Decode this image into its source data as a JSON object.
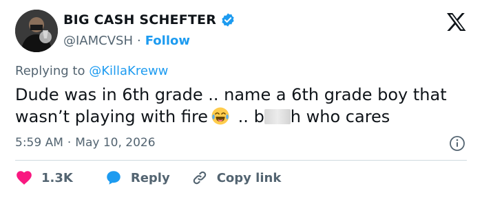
{
  "author": {
    "display_name": "BIG CASH SCHEFTER",
    "handle": "@IAMCVSH",
    "separator": "·",
    "follow_label": "Follow"
  },
  "reply_context": {
    "prefix": "Replying to",
    "mention": "@KillaKreww"
  },
  "tweet": {
    "text_part1": "Dude was in 6th grade .. name a 6th grade boy that wasn’t playing with fire",
    "text_part2": " .. b",
    "text_part3": "h who cares",
    "emoji": "face-with-tears-of-joy"
  },
  "meta": {
    "time": "5:59 AM",
    "separator": "·",
    "date": "May 10, 2026"
  },
  "actions": {
    "like_count": "1.3K",
    "reply_label": "Reply",
    "copy_label": "Copy link"
  },
  "colors": {
    "accent": "#1d9bf0",
    "like": "#f91880",
    "muted": "#536471",
    "text": "#0f1419"
  }
}
